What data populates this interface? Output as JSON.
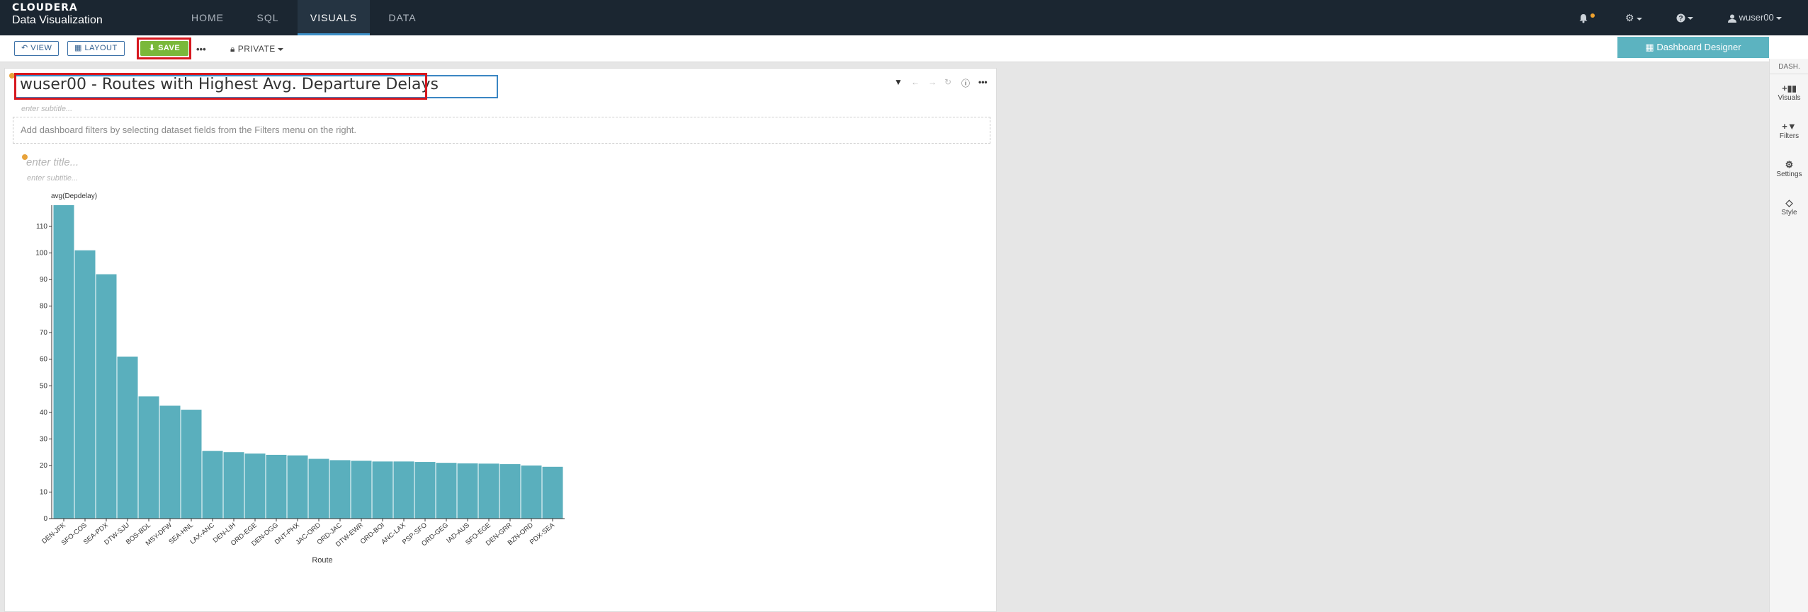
{
  "brand": {
    "line1": "CLOUDERA",
    "line2": "Data Visualization"
  },
  "nav": {
    "tabs": [
      "HOME",
      "SQL",
      "VISUALS",
      "DATA"
    ],
    "active": "VISUALS"
  },
  "user": {
    "name": "wuser00"
  },
  "toolbar": {
    "view_label": "VIEW",
    "layout_label": "LAYOUT",
    "save_label": "SAVE",
    "more_label": "•••",
    "private_label": "PRIVATE",
    "designer_label": "Dashboard Designer"
  },
  "sidebar": {
    "header": "DASH.",
    "items": [
      {
        "label": "Visuals",
        "icon": "+📊"
      },
      {
        "label": "Filters",
        "icon": "+▼"
      },
      {
        "label": "Settings",
        "icon": "⚙"
      },
      {
        "label": "Style",
        "icon": "◇"
      }
    ]
  },
  "dashboard": {
    "title": "wuser00 - Routes with Highest Avg. Departure Delays",
    "subtitle_placeholder": "enter subtitle...",
    "filter_hint": "Add dashboard filters by selecting dataset fields from the Filters menu on the right.",
    "viz_title_placeholder": "enter title...",
    "viz_subtitle_placeholder": "enter subtitle..."
  },
  "colors": {
    "accent": "#3a86c3",
    "bar": "#5aafbd",
    "save": "#7ab83a",
    "highlight": "#d7181f",
    "nav_bg": "#1b2631"
  },
  "chart_data": {
    "type": "bar",
    "ylabel": "avg(Depdelay)",
    "xlabel": "Route",
    "ylim": [
      0,
      118
    ],
    "yticks": [
      0,
      10,
      20,
      30,
      40,
      50,
      60,
      70,
      80,
      90,
      100,
      110
    ],
    "categories": [
      "DEN-JFK",
      "SFO-COS",
      "SEA-PDX",
      "DTW-SJU",
      "BOS-BDL",
      "MSY-DFW",
      "SEA-HNL",
      "LAX-ANC",
      "DEN-LIH",
      "ORD-EGE",
      "DEN-OGG",
      "DNT-PHX",
      "JAC-ORD",
      "ORD-JAC",
      "DTW-EWR",
      "ORD-BOI",
      "ANC-LAX",
      "PSP-SFO",
      "ORD-GEG",
      "IAD-AUS",
      "SFO-EGE",
      "DEN-GRR",
      "BZN-ORD",
      "PDX-SEA"
    ],
    "values": [
      118,
      101,
      92,
      61,
      46,
      42.5,
      41,
      25.5,
      25,
      24.5,
      24,
      23.8,
      22.5,
      22,
      21.8,
      21.5,
      21.5,
      21.3,
      21,
      20.8,
      20.7,
      20.5,
      20,
      19.5
    ],
    "grid": false
  }
}
